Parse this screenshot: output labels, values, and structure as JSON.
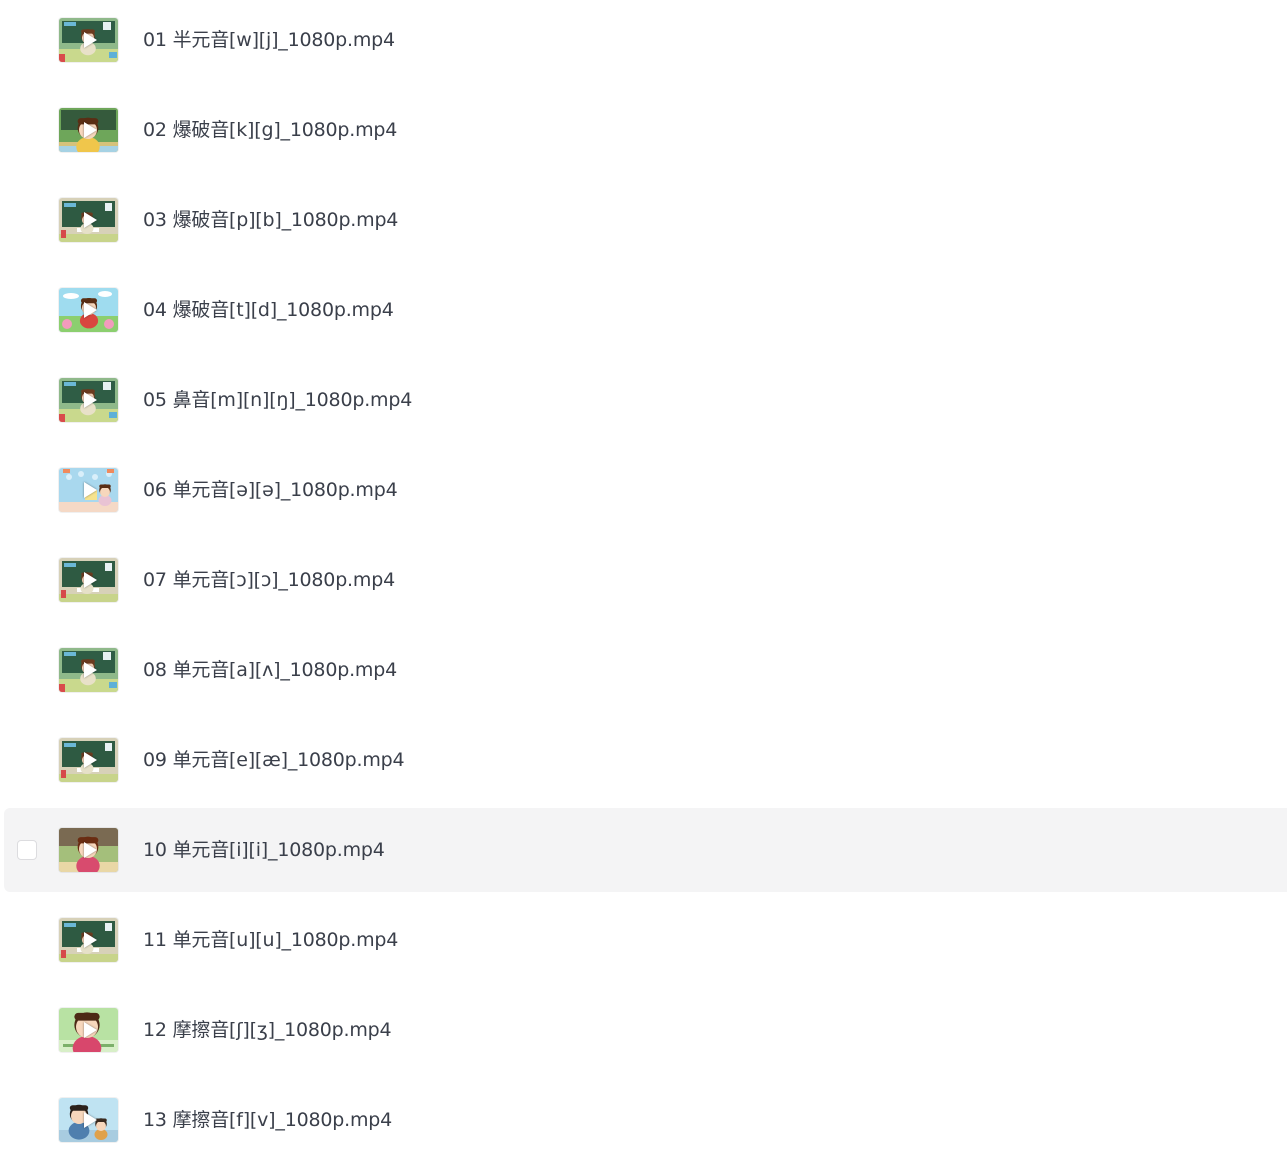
{
  "files": [
    {
      "name": "01 半元音[w][j]_1080p.mp4",
      "thumbnail": "classroom-teacher"
    },
    {
      "name": "02 爆破音[k][g]_1080p.mp4",
      "thumbnail": "teacher-closeup"
    },
    {
      "name": "03 爆破音[p][b]_1080p.mp4",
      "thumbnail": "classroom-board"
    },
    {
      "name": "04 爆破音[t][d]_1080p.mp4",
      "thumbnail": "outdoor-garden"
    },
    {
      "name": "05 鼻音[m][n][ŋ]_1080p.mp4",
      "thumbnail": "classroom-teacher"
    },
    {
      "name": "06 单元音[ə][ə]_1080p.mp4",
      "thumbnail": "blue-pattern"
    },
    {
      "name": "07 单元音[ɔ][ɔ]_1080p.mp4",
      "thumbnail": "classroom-board"
    },
    {
      "name": "08 单元音[a][ʌ]_1080p.mp4",
      "thumbnail": "classroom-teacher"
    },
    {
      "name": "09 单元音[e][æ]_1080p.mp4",
      "thumbnail": "classroom-board"
    },
    {
      "name": "10 单元音[i][i]_1080p.mp4",
      "thumbnail": "teacher-closeup-pink",
      "selected": true
    },
    {
      "name": "11 单元音[u][u]_1080p.mp4",
      "thumbnail": "classroom-board"
    },
    {
      "name": "12 摩擦音[ʃ][ʒ]_1080p.mp4",
      "thumbnail": "teacher-face-green"
    },
    {
      "name": "13 摩擦音[f][v]_1080p.mp4",
      "thumbnail": "father-child"
    }
  ],
  "colors": {
    "selected_row_bg": "#f4f4f5",
    "text": "#3a3f4a",
    "checkbox_border": "#dcdcdf"
  }
}
